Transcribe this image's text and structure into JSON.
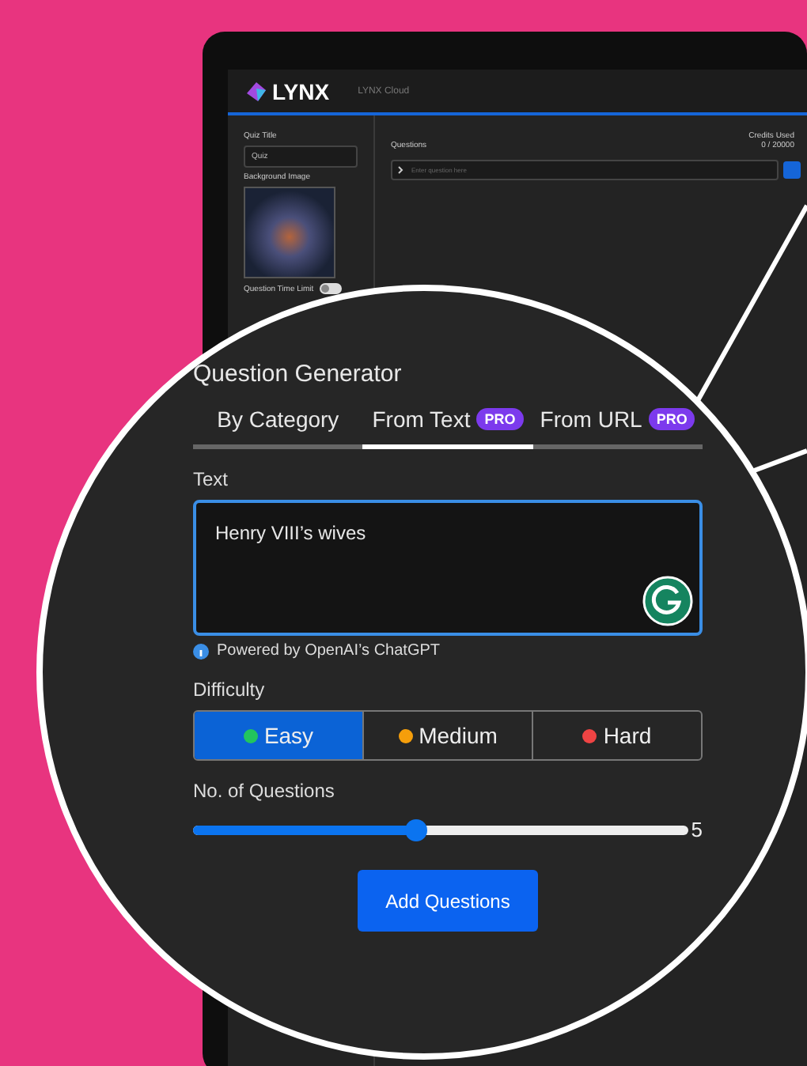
{
  "header": {
    "logo": "LYNX",
    "product": "LYNX Cloud"
  },
  "sidebar": {
    "quiz_title_label": "Quiz Title",
    "quiz_title_value": "Quiz",
    "background_image_label": "Background Image",
    "time_limit_label": "Question Time Limit",
    "time_limit_on": false
  },
  "questions": {
    "label": "Questions",
    "credits_label": "Credits Used",
    "credits": "0 / 20000",
    "placeholder": "Enter question here"
  },
  "generator": {
    "title": "Question Generator",
    "tabs": [
      {
        "label": "By Category",
        "selected": false
      },
      {
        "label": "From Text",
        "badge": "PRO",
        "selected": true
      },
      {
        "label": "From URL",
        "badge": "PRO",
        "selected": false
      }
    ],
    "text_label": "Text",
    "text_value": "Henry VIII’s wives",
    "powered_by": "Powered by OpenAI’s ChatGPT",
    "difficulty_label": "Difficulty",
    "difficulties": [
      {
        "label": "Easy",
        "color": "#22c55e",
        "selected": true
      },
      {
        "label": "Medium",
        "color": "#f59e0b",
        "selected": false
      },
      {
        "label": "Hard",
        "color": "#ef4444",
        "selected": false
      }
    ],
    "count_label": "No. of Questions",
    "count": {
      "level": 0.45,
      "value": "5"
    },
    "submit": "Add Questions"
  }
}
